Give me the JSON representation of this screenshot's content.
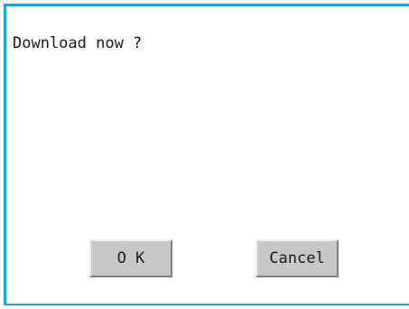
{
  "dialog": {
    "message": "Download now ?",
    "ok_label": "O K",
    "cancel_label": "Cancel"
  },
  "colors": {
    "frame": "#1ba5cf",
    "button_face": "#c7c7c7",
    "background": "#ffffff"
  }
}
